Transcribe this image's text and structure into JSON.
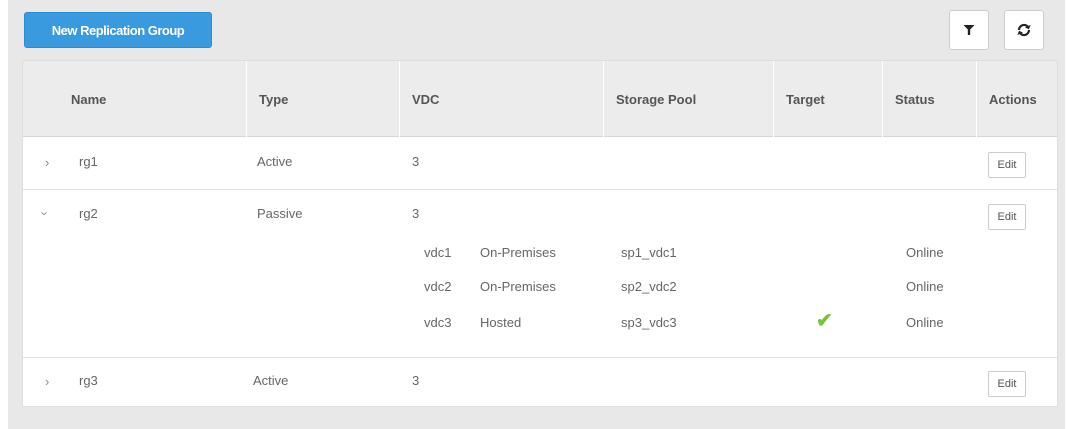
{
  "toolbar": {
    "new_button_label": "New Replication Group",
    "filter_icon": "filter-icon",
    "refresh_icon": "refresh-icon"
  },
  "table": {
    "columns": [
      "Name",
      "Type",
      "VDC",
      "Storage Pool",
      "Target",
      "Status",
      "Actions"
    ],
    "rows": [
      {
        "name": "rg1",
        "type": "Active",
        "vdc": "3",
        "expanded": false,
        "edit_label": "Edit"
      },
      {
        "name": "rg2",
        "type": "Passive",
        "vdc": "3",
        "expanded": true,
        "edit_label": "Edit",
        "details": [
          {
            "vdc": "vdc1",
            "location": "On-Premises",
            "pool": "sp1_vdc1",
            "target": false,
            "status": "Online"
          },
          {
            "vdc": "vdc2",
            "location": "On-Premises",
            "pool": "sp2_vdc2",
            "target": false,
            "status": "Online"
          },
          {
            "vdc": "vdc3",
            "location": "Hosted",
            "pool": "sp3_vdc3",
            "target": true,
            "status": "Online"
          }
        ]
      },
      {
        "name": "rg3",
        "type": "Active",
        "vdc": "3",
        "expanded": false,
        "edit_label": "Edit"
      }
    ]
  },
  "colors": {
    "primary": "#3a9ae0",
    "check": "#7cc23a"
  }
}
